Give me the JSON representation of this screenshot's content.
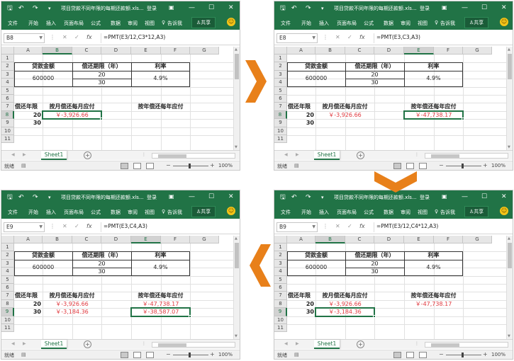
{
  "app": {
    "doc_title": "项目贷款不同年限的每期还款额.xls...",
    "login": "登录",
    "ribbon_tabs": [
      "文件",
      "开始",
      "插入",
      "页面布局",
      "公式",
      "数据",
      "审阅",
      "视图"
    ],
    "tell_me": "告诉我",
    "share": "共享",
    "status_ready": "就绪",
    "zoom": "100%",
    "sheet_tab": "Sheet1",
    "accent_color": "#217346",
    "negative_color": "#e0393e",
    "arrow_color": "#e8801a"
  },
  "grid": {
    "columns": [
      "A",
      "B",
      "C",
      "D",
      "E",
      "F",
      "G"
    ],
    "rows": [
      "1",
      "2",
      "3",
      "4",
      "5",
      "6",
      "7",
      "8",
      "9",
      "10",
      "11"
    ]
  },
  "sheet": {
    "loan_amount_header": "贷款金额",
    "period_header": "偿还期限（年）",
    "rate_header": "利率",
    "loan_amount": "600000",
    "period_20": "20",
    "period_30": "30",
    "rate": "4.9%",
    "repay_years_label": "偿还年限",
    "monthly_header": "按月偿还每月应付",
    "yearly_header": "按年偿还每年应付",
    "row8_years": "20",
    "row9_years": "30",
    "monthly_20": "￥-3,926.66",
    "monthly_30": "￥-3,184.36",
    "yearly_20": "￥-47,738.17",
    "yearly_30": "￥-38,587.07"
  },
  "panels": [
    {
      "name_box": "B8",
      "formula": "=PMT(E3/12,C3*12,A3)",
      "selected_cell": "B8",
      "selected_col": "B",
      "selected_row": "8",
      "show_monthly_30": false,
      "show_yearly_20": false,
      "show_yearly_30": false
    },
    {
      "name_box": "E8",
      "formula": "=PMT(E3,C3,A3)",
      "selected_cell": "E8",
      "selected_col": "E",
      "selected_row": "8",
      "show_monthly_30": false,
      "show_yearly_20": true,
      "show_yearly_30": false
    },
    {
      "name_box": "B9",
      "formula": "=PMT(E3/12,C4*12,A3)",
      "selected_cell": "B9",
      "selected_col": "B",
      "selected_row": "9",
      "show_monthly_30": true,
      "show_yearly_20": true,
      "show_yearly_30": false
    },
    {
      "name_box": "E9",
      "formula": "=PMT(E3,C4,A3)",
      "selected_cell": "E9",
      "selected_col": "E",
      "selected_row": "9",
      "show_monthly_30": true,
      "show_yearly_20": true,
      "show_yearly_30": true
    }
  ]
}
